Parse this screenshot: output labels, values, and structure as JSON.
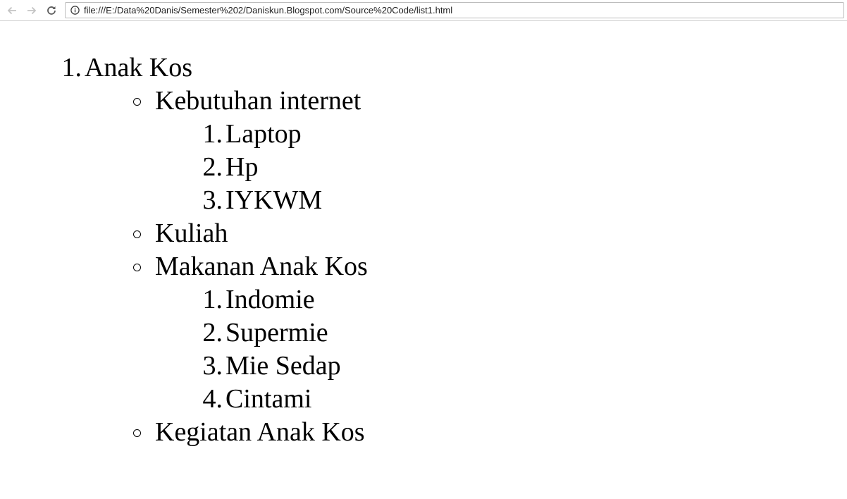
{
  "browser": {
    "url": "file:///E:/Data%20Danis/Semester%202/Daniskun.Blogspot.com/Source%20Code/list1.html"
  },
  "list": {
    "item1": {
      "marker": "1.",
      "label": "Anak Kos",
      "children": [
        {
          "label": "Kebutuhan internet",
          "children": [
            {
              "marker": "1.",
              "label": "Laptop"
            },
            {
              "marker": "2.",
              "label": "Hp"
            },
            {
              "marker": "3.",
              "label": "IYKWM"
            }
          ]
        },
        {
          "label": "Kuliah"
        },
        {
          "label": "Makanan Anak Kos",
          "children": [
            {
              "marker": "1.",
              "label": "Indomie"
            },
            {
              "marker": "2.",
              "label": "Supermie"
            },
            {
              "marker": "3.",
              "label": "Mie Sedap"
            },
            {
              "marker": "4.",
              "label": "Cintami"
            }
          ]
        },
        {
          "label": "Kegiatan Anak Kos"
        }
      ]
    }
  }
}
